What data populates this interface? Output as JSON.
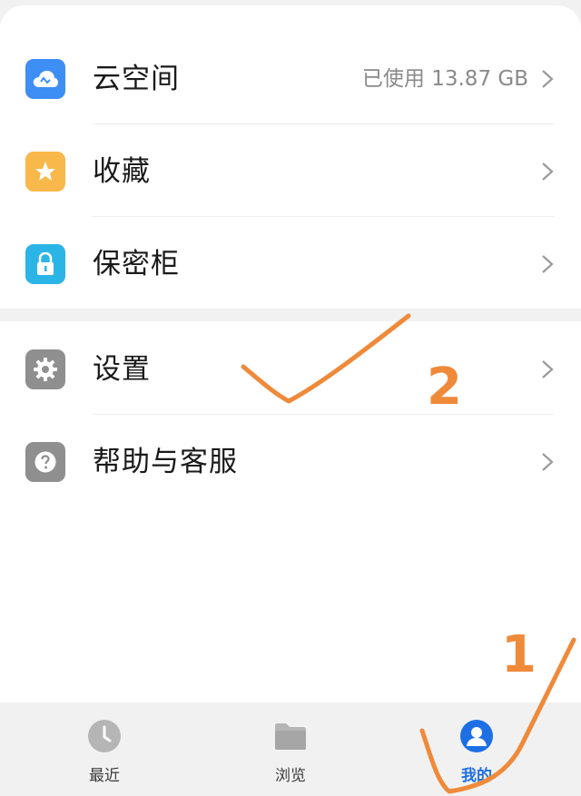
{
  "menu_group_1": [
    {
      "label": "云空间",
      "value": "已使用 13.87 GB",
      "icon": "cloud-icon",
      "color": "#3d8ef5"
    },
    {
      "label": "收藏",
      "value": "",
      "icon": "star-icon",
      "color": "#f8b84a"
    },
    {
      "label": "保密柜",
      "value": "",
      "icon": "lock-icon",
      "color": "#2bb5e6"
    }
  ],
  "menu_group_2": [
    {
      "label": "设置",
      "icon": "gear-icon",
      "color": "#8f8f8f"
    },
    {
      "label": "帮助与客服",
      "icon": "question-icon",
      "color": "#8f8f8f"
    }
  ],
  "tabbar": {
    "tabs": [
      {
        "label": "最近",
        "icon": "clock-icon"
      },
      {
        "label": "浏览",
        "icon": "folder-icon"
      },
      {
        "label": "我的",
        "icon": "user-icon",
        "active": true
      }
    ],
    "active_color": "#1e6fe6"
  },
  "annotations": {
    "handwritten_numbers": [
      "2",
      "1"
    ],
    "ink_color": "#ef8a3a"
  }
}
